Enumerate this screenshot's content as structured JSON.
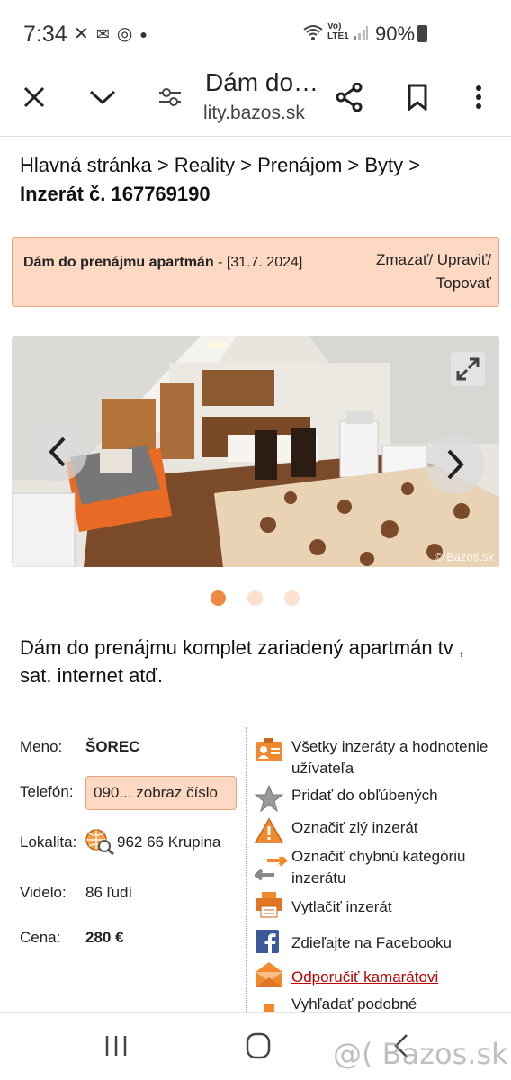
{
  "status": {
    "time": "7:34",
    "lte": "Vo)\nLTE1",
    "battery": "90%"
  },
  "toolbar": {
    "title": "Dám do…",
    "url": "lity.bazos.sk"
  },
  "breadcrumb": {
    "path": "Hlavná stránka > Reality > Prenájom > Byty >",
    "ad_number": "Inzerát č. 167769190"
  },
  "listing": {
    "title": "Dám do prenájmu apartmán",
    "date": " - [31.7. 2024]",
    "actions": "Zmazať/ Upraviť/ Topovať"
  },
  "photo": {
    "watermark": "© Bazos.sk",
    "active_slide": 1,
    "slide_count": 3
  },
  "description": "Dám do prenájmu komplet zariadený apartmán tv , sat. internet atď.",
  "details": {
    "name_label": "Meno:",
    "name_value": "ŠOREC",
    "phone_label": "Telefón:",
    "phone_value": "090... zobraz číslo",
    "location_label": "Lokalita:",
    "location_value": "962 66 Krupina",
    "views_label": "Videlo:",
    "views_value": "86 ľudí",
    "price_label": "Cena:",
    "price_value": "280 €"
  },
  "actions": [
    {
      "label": "Všetky inzeráty a hodnotenie užívateľa",
      "icon": "user-card-icon"
    },
    {
      "label": "Pridať do obľúbených",
      "icon": "star-icon"
    },
    {
      "label": "Označiť zlý inzerát",
      "icon": "warning-icon"
    },
    {
      "label": "Označiť chybnú kategóriu inzerátu",
      "icon": "arrows-icon"
    },
    {
      "label": "Vytlačiť inzerát",
      "icon": "printer-icon"
    },
    {
      "label": "Zdieľajte na Facebooku",
      "icon": "facebook-icon"
    },
    {
      "label": "Odporučiť kamarátovi",
      "icon": "envelope-icon"
    },
    {
      "label": "Vyhľadať podobné",
      "icon": "search-similar-icon"
    }
  ],
  "watermark": "@( Bazos.sk",
  "colors": {
    "accent": "#f08a42",
    "box_bg": "#fdd8c2",
    "box_border": "#e9a47f",
    "link": "#b00000"
  }
}
